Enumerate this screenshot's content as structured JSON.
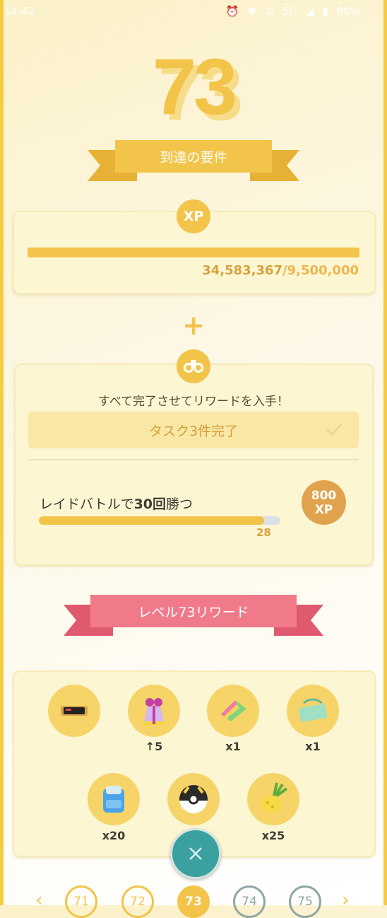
{
  "status_bar": {
    "time": "14:42",
    "network": "5G",
    "battery": "80%"
  },
  "level": {
    "current": "73"
  },
  "requirements": {
    "ribbon_label": "到達の要件",
    "xp_badge": "XP",
    "xp_current": "34,583,367",
    "xp_goal": "/9,500,000",
    "xp_progress_fraction": 1.0,
    "plus": "+"
  },
  "tasks": {
    "instruction": "すべて完了させてリワードを入手！",
    "completed_label": "タスク3件完了",
    "task_label_prefix": "レイドバトルで",
    "task_label_bold": "30回",
    "task_label_suffix": "勝つ",
    "progress_value": "28",
    "progress_fraction": 0.933,
    "reward_amount": "800",
    "reward_unit": "XP"
  },
  "rewards": {
    "ribbon_label": "レベル73リワード",
    "items": [
      {
        "icon": "sunglasses-icon",
        "qty": ""
      },
      {
        "icon": "gift-bag-icon",
        "qty": "↑5"
      },
      {
        "icon": "rainbow-candy-icon",
        "qty": "x1"
      },
      {
        "icon": "pass-ticket-icon",
        "qty": "x1"
      },
      {
        "icon": "backpack-icon",
        "qty": "x20"
      },
      {
        "icon": "ultra-ball-icon",
        "qty": ""
      },
      {
        "icon": "pinap-berry-icon",
        "qty": "x25"
      }
    ]
  },
  "navigation": {
    "prev": "‹",
    "next": "›",
    "levels": [
      "71",
      "72",
      "73",
      "74",
      "75"
    ],
    "current_level": "73"
  },
  "colors": {
    "gold": "#f2c44a",
    "pink": "#f07a8a",
    "teal": "#3aa0a0"
  }
}
